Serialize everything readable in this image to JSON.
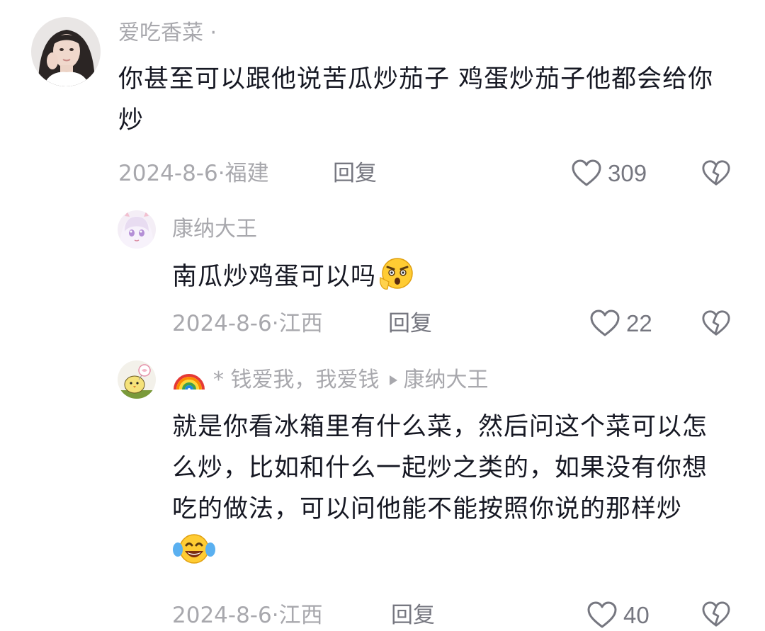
{
  "comments": [
    {
      "username": "爱吃香菜 ·",
      "text": "你甚至可以跟他说苦瓜炒茄子 鸡蛋炒茄子他都会给你炒",
      "date": "2024-8-6·",
      "location": "福建",
      "reply_label": "回复",
      "likes": "309",
      "avatar_icon": "woman-photo-avatar"
    },
    {
      "username": "康纳大王",
      "text": "南瓜炒鸡蛋可以吗",
      "emoji": "shocked-face-emoji",
      "date": "2024-8-6·",
      "location": "江西",
      "reply_label": "回复",
      "likes": "22",
      "avatar_icon": "anime-girl-avatar"
    },
    {
      "username": "* 钱爱我，我爱钱",
      "name_prefix_icon": "rainbow-emoji",
      "reply_to": "康纳大王",
      "text": "就是你看冰箱里有什么菜，然后问这个菜可以怎么炒，比如和什么一起炒之类的，如果没有你想吃的做法，可以问他能不能按照你说的那样炒",
      "emoji": "laughing-tears-emoji",
      "date": "2024-8-6·",
      "location": "江西",
      "reply_label": "回复",
      "likes": "40",
      "avatar_icon": "cartoon-chick-avatar"
    }
  ],
  "colors": {
    "text_primary": "#161823",
    "text_secondary": "#a8a8ad",
    "action": "#767780"
  }
}
